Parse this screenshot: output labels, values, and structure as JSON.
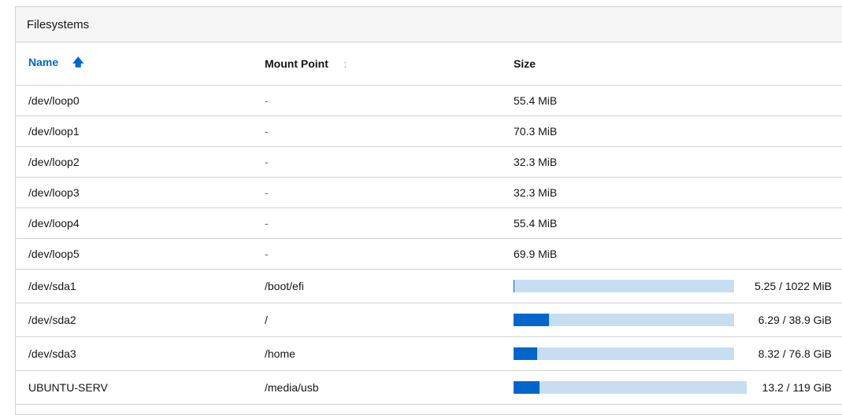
{
  "card": {
    "title": "Filesystems"
  },
  "columns": {
    "name": "Name",
    "mount": "Mount Point",
    "size": "Size"
  },
  "icons": {
    "sorted": "arrow-up-icon",
    "unsorted": "sort-icon"
  },
  "colors": {
    "accent": "#0066cc",
    "track": "#c7ddf2",
    "border": "#d2d2d2"
  },
  "rows": [
    {
      "name": "/dev/loop0",
      "mount": "-",
      "size": "55.4 MiB"
    },
    {
      "name": "/dev/loop1",
      "mount": "-",
      "size": "70.3 MiB"
    },
    {
      "name": "/dev/loop2",
      "mount": "-",
      "size": "32.3 MiB"
    },
    {
      "name": "/dev/loop3",
      "mount": "-",
      "size": "32.3 MiB"
    },
    {
      "name": "/dev/loop4",
      "mount": "-",
      "size": "55.4 MiB"
    },
    {
      "name": "/dev/loop5",
      "mount": "-",
      "size": "69.9 MiB"
    },
    {
      "name": "/dev/sda1",
      "mount": "/boot/efi",
      "usage": "5.25 / 1022 MiB",
      "used_fraction": 0.005
    },
    {
      "name": "/dev/sda2",
      "mount": "/",
      "usage": "6.29 / 38.9 GiB",
      "used_fraction": 0.162
    },
    {
      "name": "/dev/sda3",
      "mount": "/home",
      "usage": "8.32 / 76.8 GiB",
      "used_fraction": 0.108
    },
    {
      "name": "UBUNTU-SERV",
      "mount": "/media/usb",
      "usage": "13.2 / 119 GiB",
      "used_fraction": 0.111
    }
  ]
}
